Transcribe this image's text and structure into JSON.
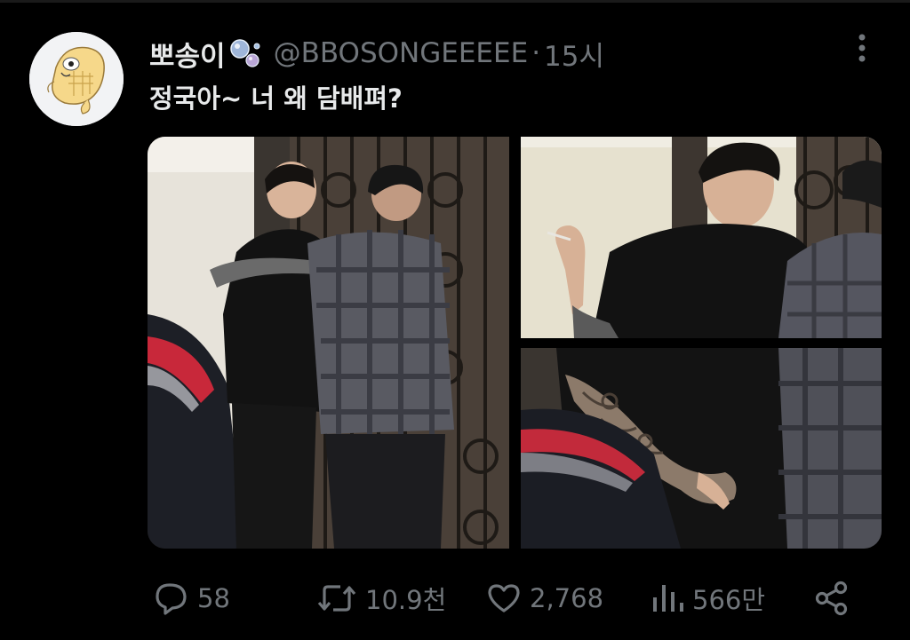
{
  "post": {
    "display_name": "뽀송이",
    "handle": "@BBOSONGEEEEE",
    "separator": "·",
    "time": "15시",
    "text": "정국아~ 너 왜 담배펴?"
  },
  "actions": {
    "replies": "58",
    "reposts": "10.9천",
    "likes": "2,768",
    "views": "566만"
  },
  "icons": {
    "name_badge": "bubbles-icon",
    "more": "more-vertical-icon",
    "reply": "reply-icon",
    "repost": "repost-icon",
    "like": "heart-icon",
    "views": "views-icon",
    "share": "share-icon"
  },
  "colors": {
    "background": "#000000",
    "primary_text": "#e7e9ea",
    "secondary_text": "#71767b"
  }
}
